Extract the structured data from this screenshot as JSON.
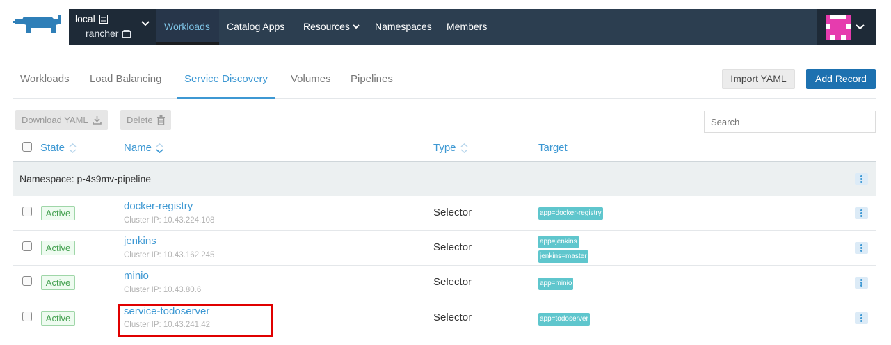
{
  "topnav": {
    "cluster_name": "local",
    "project_name": "rancher",
    "items": [
      "Workloads",
      "Catalog Apps",
      "Resources",
      "Namespaces",
      "Members"
    ],
    "active_index": 0
  },
  "subtabs": {
    "items": [
      "Workloads",
      "Load Balancing",
      "Service Discovery",
      "Volumes",
      "Pipelines"
    ],
    "active_index": 2
  },
  "actions": {
    "import_yaml": "Import YAML",
    "add_record": "Add Record",
    "download_yaml": "Download YAML",
    "delete": "Delete",
    "search_placeholder": "Search"
  },
  "table": {
    "headers": {
      "state": "State",
      "name": "Name",
      "type": "Type",
      "target": "Target"
    },
    "namespace_label": "Namespace: p-4s9mv-pipeline",
    "rows": [
      {
        "state": "Active",
        "name": "docker-registry",
        "ip": "Cluster IP: 10.43.224.108",
        "type": "Selector",
        "targets": [
          "app=docker-registry"
        ]
      },
      {
        "state": "Active",
        "name": "jenkins",
        "ip": "Cluster IP: 10.43.162.245",
        "type": "Selector",
        "targets": [
          "app=jenkins",
          "jenkins=master"
        ]
      },
      {
        "state": "Active",
        "name": "minio",
        "ip": "Cluster IP: 10.43.80.6",
        "type": "Selector",
        "targets": [
          "app=minio"
        ]
      },
      {
        "state": "Active",
        "name": "service-todoserver",
        "ip": "Cluster IP: 10.43.241.42",
        "type": "Selector",
        "targets": [
          "app=todoserver"
        ]
      }
    ]
  },
  "colors": {
    "navbar": "#2c3e50",
    "accent": "#3d98d3",
    "primary_button": "#1d71b0",
    "active_badge": "#43a04f",
    "target_tag": "#5fc6cd",
    "highlight_box": "#e00000"
  },
  "icons": [
    "rancher-logo-icon",
    "cluster-icon",
    "project-icon",
    "chevron-down-icon",
    "download-icon",
    "trash-icon",
    "sort-icon",
    "kebab-menu-icon",
    "user-avatar-icon"
  ]
}
